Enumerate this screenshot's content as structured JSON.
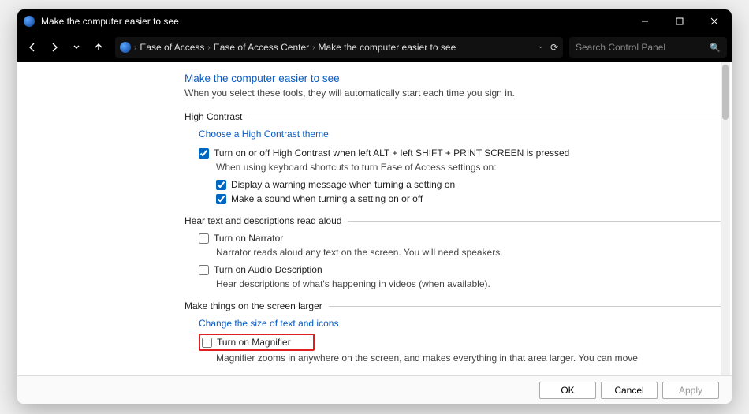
{
  "window": {
    "title": "Make the computer easier to see"
  },
  "breadcrumb": {
    "root": "Ease of Access",
    "middle": "Ease of Access Center",
    "leaf": "Make the computer easier to see"
  },
  "search": {
    "placeholder": "Search Control Panel"
  },
  "page": {
    "heading": "Make the computer easier to see",
    "sub": "When you select these tools, they will automatically start each time you sign in."
  },
  "highContrast": {
    "section": "High Contrast",
    "link": "Choose a High Contrast theme",
    "chk_toggle": "Turn on or off High Contrast when left ALT + left SHIFT + PRINT SCREEN is pressed",
    "note": "When using keyboard shortcuts to turn Ease of Access settings on:",
    "chk_warn": "Display a warning message when turning a setting on",
    "chk_sound": "Make a sound when turning a setting on or off"
  },
  "readAloud": {
    "section": "Hear text and descriptions read aloud",
    "chk_narrator": "Turn on Narrator",
    "desc_narrator": "Narrator reads aloud any text on the screen. You will need speakers.",
    "chk_audio": "Turn on Audio Description",
    "desc_audio": "Hear descriptions of what's happening in videos (when available)."
  },
  "larger": {
    "section": "Make things on the screen larger",
    "link": "Change the size of text and icons",
    "chk_mag": "Turn on Magnifier",
    "desc_mag": "Magnifier zooms in anywhere on the screen, and makes everything in that area larger. You can move"
  },
  "buttons": {
    "ok": "OK",
    "cancel": "Cancel",
    "apply": "Apply"
  }
}
